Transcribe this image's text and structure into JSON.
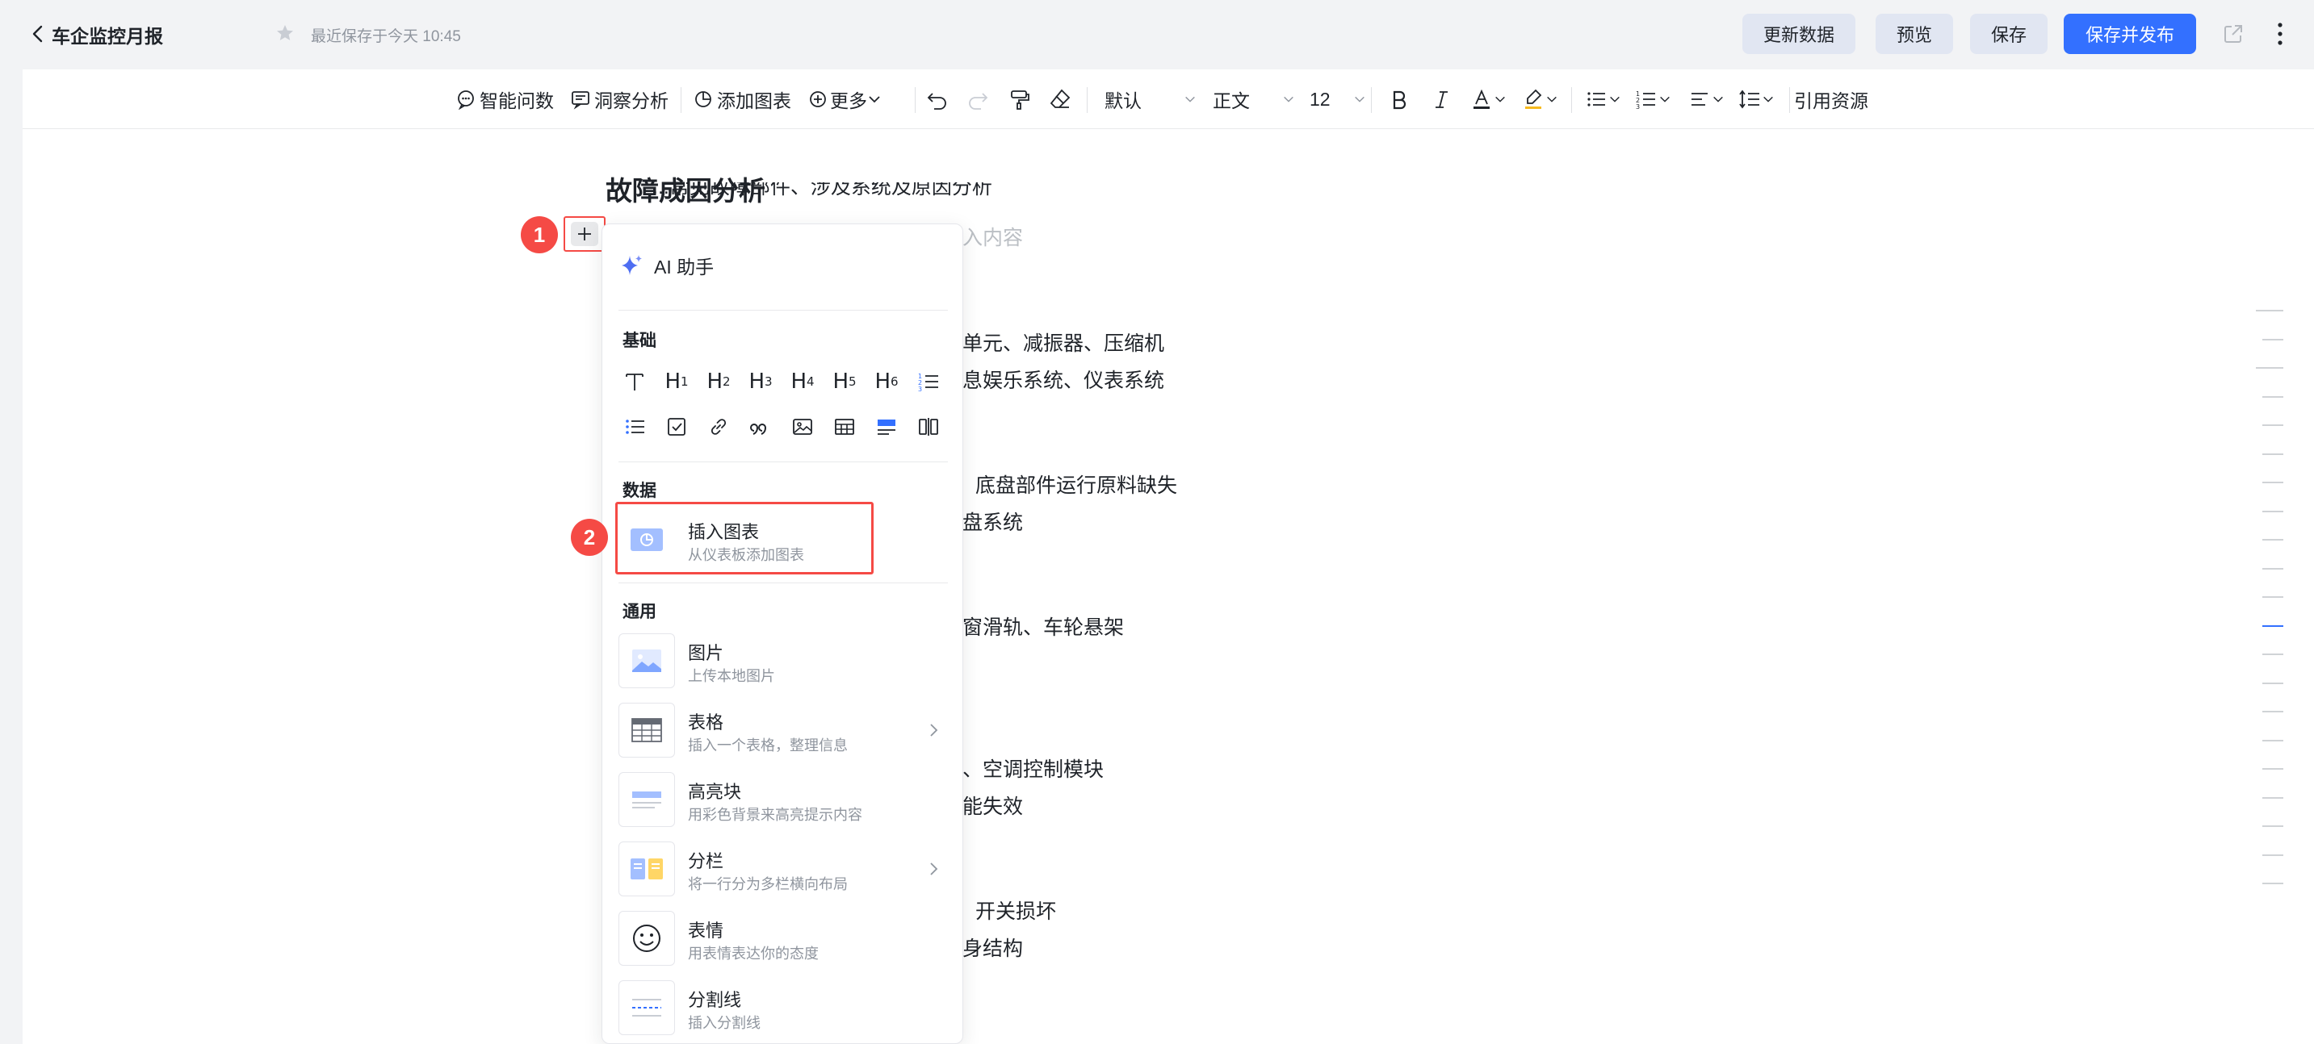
{
  "header": {
    "title": "车企监控月报",
    "save_status": "最近保存于今天 10:45",
    "btn_update": "更新数据",
    "btn_preview": "预览",
    "btn_save": "保存",
    "btn_publish": "保存并发布"
  },
  "toolbar": {
    "smart_qa": "智能问数",
    "insight": "洞察分析",
    "add_chart": "添加图表",
    "more": "更多",
    "font_family": "默认",
    "paragraph_style": "正文",
    "font_size": "12",
    "cite": "引用资源"
  },
  "doc": {
    "cut_line": "...常见故障部件、涉及系统及原因分析",
    "heading": "故障成因分析",
    "placeholder": "入内容",
    "lines": [
      "单元、减振器、压缩机",
      "息娱乐系统、仪表系统",
      "底盘部件运行原料缺失",
      "盘系统",
      "窗滑轨、车轮悬架",
      "、空调控制模块",
      "能失效",
      "开关损坏",
      "身结构"
    ]
  },
  "annotations": {
    "badge1": "1",
    "badge2": "2"
  },
  "menu": {
    "ai_label": "AI 助手",
    "basic_label": "基础",
    "data_label": "数据",
    "general_label": "通用",
    "heading_icons": [
      "H",
      "H",
      "H",
      "H",
      "H",
      "H"
    ],
    "heading_levels": [
      "1",
      "2",
      "3",
      "4",
      "5",
      "6"
    ],
    "insert_chart": {
      "title": "插入图表",
      "desc": "从仪表板添加图表"
    },
    "items": [
      {
        "title": "图片",
        "desc": "上传本地图片"
      },
      {
        "title": "表格",
        "desc": "插入一个表格，整理信息"
      },
      {
        "title": "高亮块",
        "desc": "用彩色背景来高亮提示内容"
      },
      {
        "title": "分栏",
        "desc": "将一行分为多栏横向布局"
      },
      {
        "title": "表情",
        "desc": "用表情表达你的态度"
      },
      {
        "title": "分割线",
        "desc": "插入分割线"
      }
    ]
  },
  "colors": {
    "primary": "#3370ff",
    "annotation": "#f54a45"
  }
}
